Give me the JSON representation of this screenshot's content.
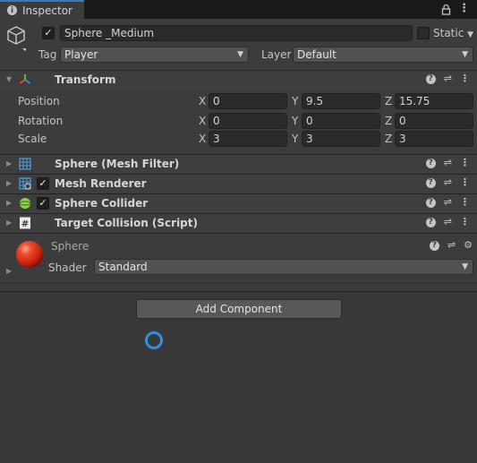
{
  "tab": {
    "title": "Inspector",
    "icon": "info-icon"
  },
  "object": {
    "active": true,
    "name": "Sphere _Medium",
    "static_label": "Static",
    "static_checked": false,
    "tag_label": "Tag",
    "tag_value": "Player",
    "layer_label": "Layer",
    "layer_value": "Default"
  },
  "transform": {
    "title": "Transform",
    "position": {
      "label": "Position",
      "x": "0",
      "y": "9.5",
      "z": "15.75"
    },
    "rotation": {
      "label": "Rotation",
      "x": "0",
      "y": "0",
      "z": "0"
    },
    "scale": {
      "label": "Scale",
      "x": "3",
      "y": "3",
      "z": "3"
    },
    "axes": {
      "x": "X",
      "y": "Y",
      "z": "Z"
    }
  },
  "components": [
    {
      "title": "Sphere (Mesh Filter)",
      "has_checkbox": false,
      "checked": false,
      "icon": "mesh-filter-icon"
    },
    {
      "title": "Mesh Renderer",
      "has_checkbox": true,
      "checked": true,
      "icon": "mesh-renderer-icon"
    },
    {
      "title": "Sphere Collider",
      "has_checkbox": true,
      "checked": true,
      "icon": "sphere-collider-icon"
    },
    {
      "title": "Target Collision (Script)",
      "has_checkbox": false,
      "checked": false,
      "icon": "script-icon"
    }
  ],
  "material": {
    "name": "Sphere",
    "shader_label": "Shader",
    "shader_value": "Standard"
  },
  "add_component_label": "Add Component",
  "colors": {
    "accent": "#3a79bb",
    "panel": "#3c3c3c",
    "ring": "#2f8fe6",
    "sphere": "#e0311a"
  }
}
